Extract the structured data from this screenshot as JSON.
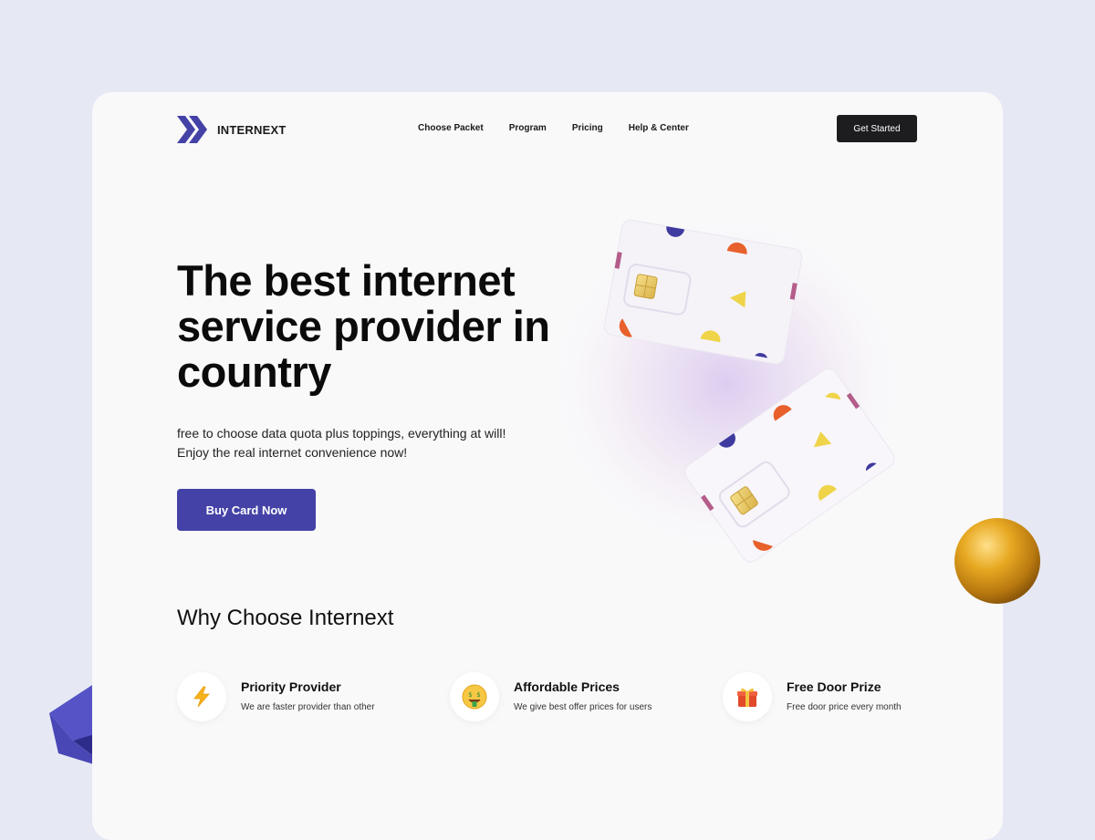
{
  "brand": {
    "name": "INTERNEXT",
    "color": "#4442a6"
  },
  "nav": {
    "items": [
      "Choose Packet",
      "Program",
      "Pricing",
      "Help & Center"
    ]
  },
  "header": {
    "cta_label": "Get Started"
  },
  "hero": {
    "title": "The best internet service provider in country",
    "subtitle_line1": "free to choose data quota plus toppings, everything at will!",
    "subtitle_line2": "Enjoy the real internet convenience now!",
    "cta_label": "Buy Card Now"
  },
  "why": {
    "title": "Why Choose Internext",
    "features": [
      {
        "icon": "lightning-icon",
        "title": "Priority Provider",
        "desc": "We are faster provider than other"
      },
      {
        "icon": "money-face-icon",
        "title": "Affordable Prices",
        "desc": "We give best offer prices for users"
      },
      {
        "icon": "gift-icon",
        "title": "Free Door Prize",
        "desc": "Free door price every month"
      }
    ]
  },
  "colors": {
    "accent": "#4442a6",
    "dark": "#1d1d1f",
    "page_bg": "#e6e9f4",
    "card_bg": "#f9f9fa",
    "sphere": "#e0a21c"
  }
}
